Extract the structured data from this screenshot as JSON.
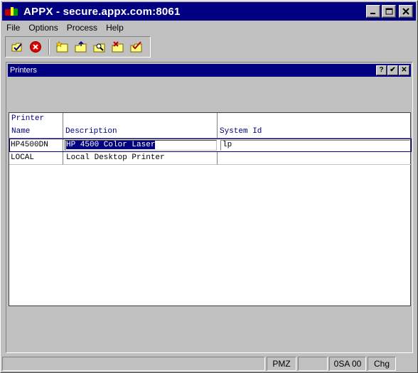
{
  "window": {
    "title": "APPX - secure.appx.com:8061"
  },
  "title_buttons": {
    "minimize": "_",
    "maximize": "□",
    "close": "✕"
  },
  "menu": [
    "File",
    "Options",
    "Process",
    "Help"
  ],
  "toolbar": {
    "icons": [
      "check-folder-icon",
      "cancel-icon",
      "new-folder-icon",
      "open-folder-icon",
      "search-folder-icon",
      "delete-folder-icon",
      "checklist-folder-icon"
    ]
  },
  "child_window": {
    "title": "Printers",
    "buttons": {
      "help": "?",
      "ok": "✔",
      "close": "✕"
    }
  },
  "grid": {
    "columns": [
      {
        "line1": "Printer",
        "line2": "Name"
      },
      {
        "line1": "",
        "line2": "Description"
      },
      {
        "line1": "",
        "line2": "System Id"
      }
    ],
    "rows": [
      {
        "name": "HP4500DN",
        "description": "HP 4500 Color Laser",
        "system_id": "lp"
      },
      {
        "name": "LOCAL",
        "description": "Local Desktop Printer",
        "system_id": ""
      }
    ]
  },
  "statusbar": {
    "user": "PMZ",
    "session": "0SA 00",
    "mode": "Chg"
  },
  "colors": {
    "titlebar": "#000080",
    "chrome": "#c0c0c0",
    "header_text": "#000080"
  }
}
